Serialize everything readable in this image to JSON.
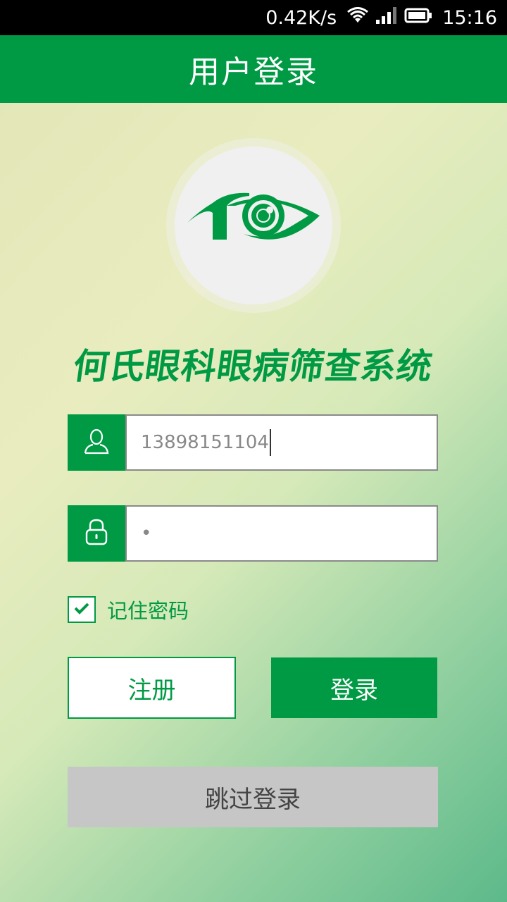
{
  "status_bar": {
    "network_speed": "0.42K/s",
    "time": "15:16",
    "icons": [
      "wifi-icon",
      "signal-icon",
      "battery-icon"
    ]
  },
  "header": {
    "title": "用户登录"
  },
  "app": {
    "logo_icon": "eye-logo-icon",
    "system_name": "何氏眼科眼病筛查系统"
  },
  "login_form": {
    "username_value": "13898151104",
    "password_value": "•",
    "remember_label": "记住密码",
    "remember_checked": true,
    "register_label": "注册",
    "login_label": "登录",
    "skip_label": "跳过登录"
  },
  "colors": {
    "primary": "#009a44",
    "skip_button_bg": "#c6c6c6"
  }
}
